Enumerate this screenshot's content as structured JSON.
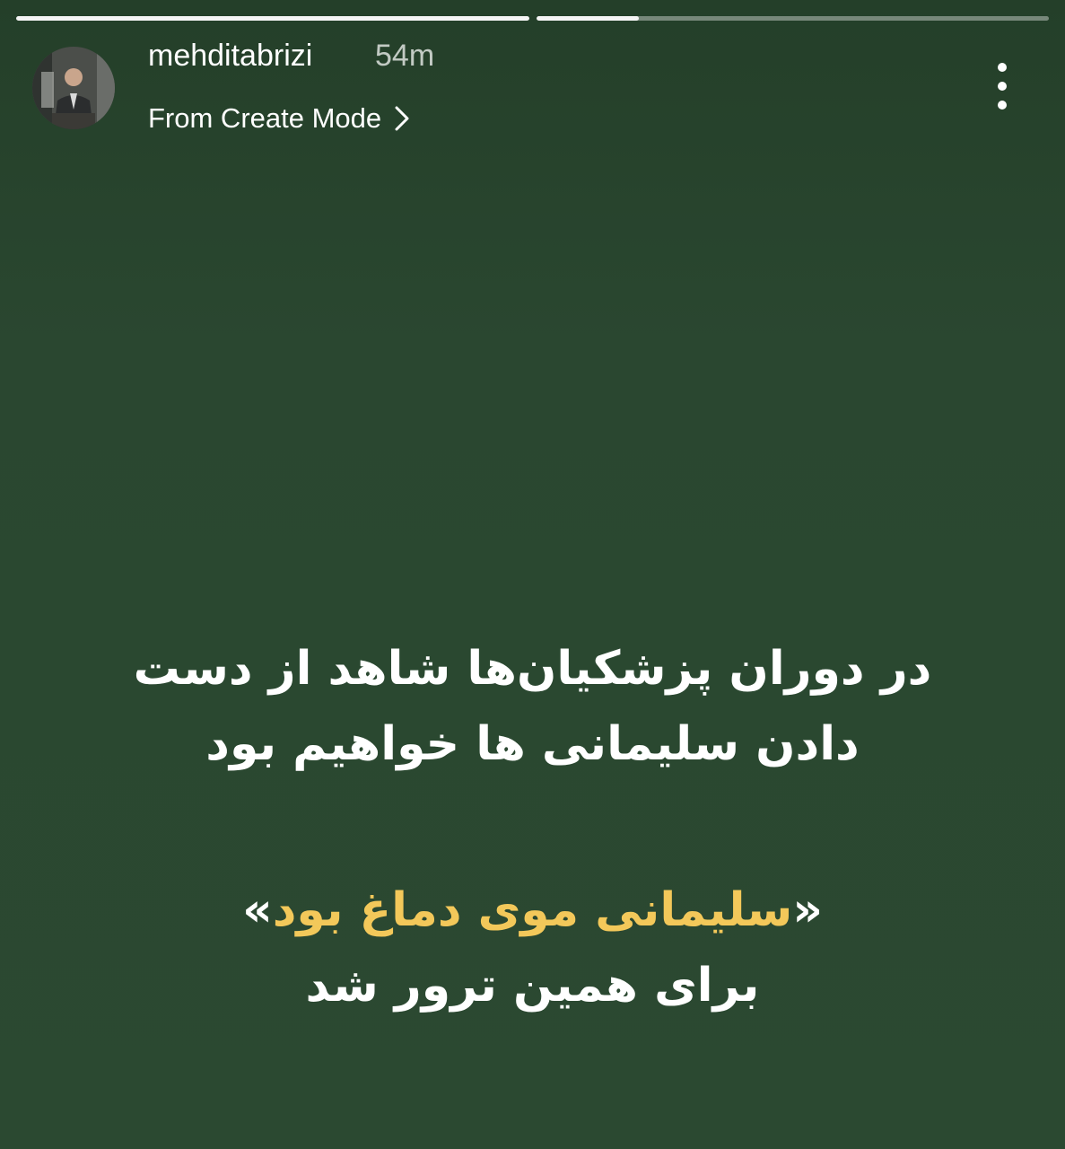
{
  "story": {
    "background_color": "#2a4730",
    "progress_segments": [
      {
        "fill_fraction": 1.0
      },
      {
        "fill_fraction": 0.2
      }
    ]
  },
  "header": {
    "username": "mehditabrizi",
    "timestamp": "54m",
    "subtitle": "From Create Mode",
    "subtitle_icon": "chevron-right-icon",
    "more_icon": "more-vertical-icon"
  },
  "caption": {
    "line1": "در دوران پزشکیان‌ها شاهد از دست",
    "line2": "دادن سلیمانی ها خواهیم بود",
    "quote_open": "«",
    "quote_text": "سلیمانی موی دماغ بود",
    "quote_close": "»",
    "line4": "برای همین ترور شد",
    "highlight_color": "#f3c85a"
  }
}
